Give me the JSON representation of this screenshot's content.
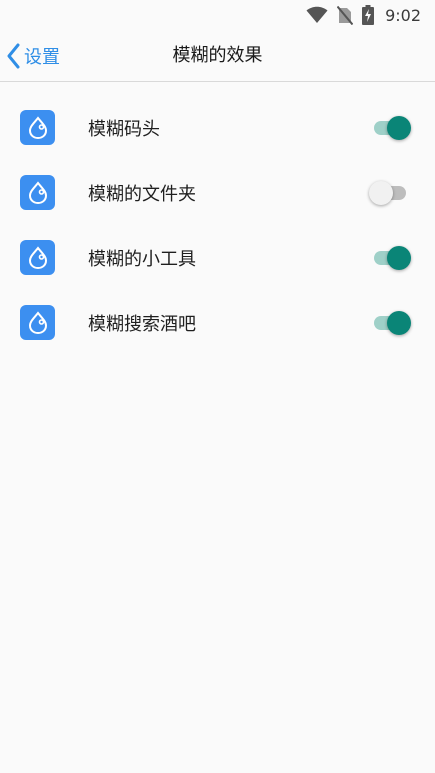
{
  "status_bar": {
    "time": "9:02",
    "icons": [
      "wifi-icon",
      "no-sim-icon",
      "battery-charging-icon"
    ]
  },
  "nav": {
    "back_label": "设置",
    "title": "模糊的效果"
  },
  "items": [
    {
      "label": "模糊码头",
      "enabled": true
    },
    {
      "label": "模糊的文件夹",
      "enabled": false
    },
    {
      "label": "模糊的小工具",
      "enabled": true
    },
    {
      "label": "模糊搜索酒吧",
      "enabled": true
    }
  ],
  "colors": {
    "accent": "#2f8ee6",
    "toggle_on": "#0a8577",
    "app_icon": "#3c8ff0"
  }
}
